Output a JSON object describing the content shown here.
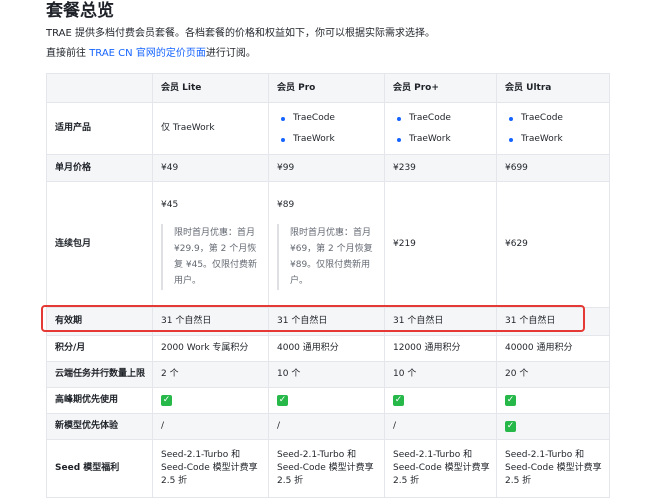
{
  "title": "套餐总览",
  "intro": "TRAE 提供多档付费会员套餐。各档套餐的价格和权益如下，你可以根据实际需求选择。",
  "note": {
    "prefix": "直接前往 ",
    "link": "TRAE CN 官网的定价页面",
    "suffix": "进行订阅。"
  },
  "table": {
    "headers": [
      "",
      "会员 Lite",
      "会员 Pro",
      "会员 Pro+",
      "会员 Ultra"
    ],
    "products": {
      "label": "适用产品",
      "lite": "仅 TraeWork",
      "pro": [
        "TraeCode",
        "TraeWork"
      ],
      "proplus": [
        "TraeCode",
        "TraeWork"
      ],
      "ultra": [
        "TraeCode",
        "TraeWork"
      ]
    },
    "monthly": {
      "label": "单月价格",
      "values": [
        "¥49",
        "¥99",
        "¥239",
        "¥699"
      ]
    },
    "continuous": {
      "label": "连续包月",
      "lite_price": "¥45",
      "lite_promo": "限时首月优惠：首月 ¥29.9，第 2 个月恢复 ¥45。仅限付费新用户。",
      "pro_price": "¥89",
      "pro_promo": "限时首月优惠：首月 ¥69，第 2 个月恢复 ¥89。仅限付费新用户。",
      "proplus": "¥219",
      "ultra": "¥629"
    },
    "validity": {
      "label": "有效期",
      "values": [
        "31 个自然日",
        "31 个自然日",
        "31 个自然日",
        "31 个自然日"
      ]
    },
    "credits": {
      "label": "积分/月",
      "values": [
        "2000 Work 专属积分",
        "4000 通用积分",
        "12000 通用积分",
        "40000 通用积分"
      ]
    },
    "tasks": {
      "label": "云端任务并行数量上限",
      "values": [
        "2 个",
        "10 个",
        "10 个",
        "20 个"
      ]
    },
    "peak": {
      "label": "高峰期优先使用",
      "values": [
        true,
        true,
        true,
        true
      ]
    },
    "newmodel": {
      "label": "新模型优先体验",
      "values": [
        "/",
        "/",
        "/",
        true
      ]
    },
    "seed": {
      "label": "Seed 模型福利",
      "values": [
        "Seed-2.1-Turbo 和 Seed-Code 模型计费享 2.5 折",
        "Seed-2.1-Turbo 和 Seed-Code 模型计费享 2.5 折",
        "Seed-2.1-Turbo 和 Seed-Code 模型计费享 2.5 折",
        "Seed-2.1-Turbo 和 Seed-Code 模型计费享 2.5 折"
      ]
    }
  },
  "colors": {
    "link": "#1664ff",
    "highlight": "#e53935",
    "check": "#27b84a"
  }
}
